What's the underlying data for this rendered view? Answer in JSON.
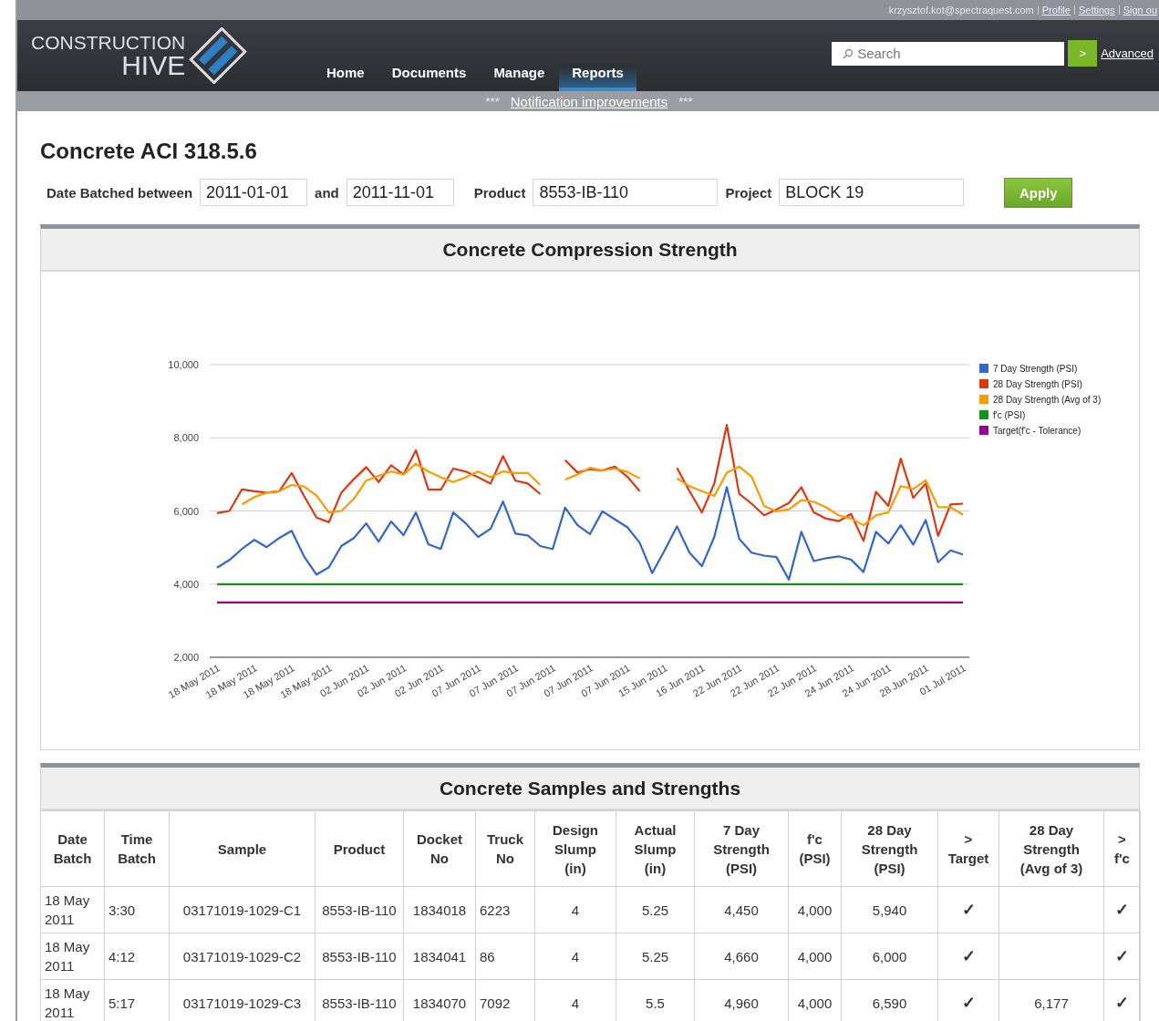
{
  "top_bar": {
    "user": "krzysztof.kot@spectraquest.com",
    "links": [
      "Profile",
      "Settings",
      "Sign ou"
    ]
  },
  "logo": {
    "line1": "CONSTRUCTION",
    "line2": "HIVE"
  },
  "nav": [
    {
      "label": "Home",
      "selected": false
    },
    {
      "label": "Documents",
      "selected": false
    },
    {
      "label": "Manage",
      "selected": false
    },
    {
      "label": "Reports",
      "selected": true
    }
  ],
  "search": {
    "placeholder": "Search",
    "go": ">",
    "advanced": "Advanced"
  },
  "notice": {
    "stars_left": "***",
    "link": "Notification improvements",
    "stars_right": "***"
  },
  "title": "Concrete ACI 318.5.6",
  "filters": {
    "date_label": "Date Batched between",
    "date_from": "2011-01-01",
    "and": "and",
    "date_to": "2011-11-01",
    "product_label": "Product",
    "product": "8553-IB-110",
    "project_label": "Project",
    "project": "BLOCK 19",
    "apply": "Apply"
  },
  "chart_panel": {
    "title": "Concrete Compression Strength",
    "chart_data": {
      "type": "line",
      "categories": [
        "18 May 2011",
        null,
        null,
        "18 May 2011",
        null,
        null,
        "18 May 2011",
        null,
        null,
        "18 May 2011",
        null,
        null,
        "02 Jun 2011",
        null,
        null,
        "02 Jun 2011",
        null,
        null,
        "02 Jun 2011",
        null,
        null,
        "07 Jun 2011",
        null,
        null,
        "07 Jun 2011",
        null,
        null,
        "07 Jun 2011",
        null,
        null,
        "07 Jun 2011",
        null,
        null,
        "07 Jun 2011",
        null,
        null,
        "15 Jun 2011",
        null,
        null,
        "16 Jun 2011",
        null,
        null,
        "22 Jun 2011",
        null,
        null,
        "22 Jun 2011",
        null,
        null,
        "22 Jun 2011",
        null,
        null,
        "24 Jun 2011",
        null,
        null,
        "24 Jun 2011",
        null,
        null,
        "28 Jun 2011",
        null,
        null,
        "01 Jul 2011"
      ],
      "ylim": [
        2000,
        10000
      ],
      "grid": true,
      "legend": "right",
      "yticks": [
        {
          "value": 2000,
          "label": "2,000"
        },
        {
          "value": 4000,
          "label": "4,000"
        },
        {
          "value": 6000,
          "label": "6,000"
        },
        {
          "value": 8000,
          "label": "8,000"
        },
        {
          "value": 10000,
          "label": "10,000"
        }
      ],
      "series": [
        {
          "name": "7 Day Strength (PSI)",
          "color": "#3366cc",
          "values": [
            4450,
            4660,
            4960,
            5210,
            5010,
            5260,
            5460,
            4760,
            4260,
            4460,
            5040,
            5260,
            5660,
            5160,
            5710,
            5340,
            5960,
            5090,
            4960,
            5960,
            5660,
            5290,
            5510,
            6260,
            5380,
            5330,
            5040,
            4960,
            6090,
            5610,
            5370,
            5990,
            5770,
            5560,
            5130,
            4300,
            4920,
            5580,
            4860,
            4490,
            5290,
            6650,
            5240,
            4860,
            4780,
            4740,
            4120,
            5430,
            4630,
            4710,
            4760,
            4670,
            4330,
            5430,
            5110,
            5610,
            5080,
            5750,
            4600,
            4920,
            4810
          ]
        },
        {
          "name": "28 Day Strength (PSI)",
          "color": "#dc3912",
          "values": [
            5940,
            6000,
            6590,
            6540,
            6500,
            6540,
            7040,
            6410,
            5820,
            5690,
            6500,
            6870,
            7200,
            6790,
            7250,
            7000,
            7660,
            6580,
            6580,
            7160,
            7080,
            6920,
            6750,
            7500,
            6830,
            6750,
            6460,
            null,
            7390,
            7050,
            7140,
            7110,
            7210,
            6940,
            6540,
            null,
            null,
            7180,
            6540,
            5960,
            6750,
            8350,
            6470,
            6200,
            5880,
            6040,
            6220,
            6650,
            5960,
            5790,
            5720,
            5920,
            5180,
            6520,
            6140,
            7430,
            6360,
            6750,
            5320,
            6180,
            6200
          ]
        },
        {
          "name": "28 Day Strength (Avg of 3)",
          "color": "#ff9900",
          "values": [
            null,
            null,
            6180,
            6380,
            6500,
            6540,
            6710,
            6670,
            6420,
            5960,
            6000,
            6330,
            6830,
            6960,
            7080,
            7000,
            7290,
            7080,
            6920,
            6790,
            6920,
            7080,
            6920,
            7080,
            7040,
            7040,
            6710,
            null,
            6860,
            7000,
            7180,
            7110,
            7160,
            7070,
            6890,
            null,
            null,
            6890,
            6680,
            6540,
            6410,
            7050,
            7210,
            6940,
            6140,
            5990,
            6040,
            6300,
            6250,
            6100,
            5880,
            5790,
            5610,
            5880,
            5960,
            6680,
            6600,
            6840,
            6110,
            6100,
            5900
          ]
        },
        {
          "name": "f'c (PSI)",
          "color": "#109618",
          "values": [
            4000,
            4000,
            4000,
            4000,
            4000,
            4000,
            4000,
            4000,
            4000,
            4000,
            4000,
            4000,
            4000,
            4000,
            4000,
            4000,
            4000,
            4000,
            4000,
            4000,
            4000,
            4000,
            4000,
            4000,
            4000,
            4000,
            4000,
            4000,
            4000,
            4000,
            4000,
            4000,
            4000,
            4000,
            4000,
            4000,
            4000,
            4000,
            4000,
            4000,
            4000,
            4000,
            4000,
            4000,
            4000,
            4000,
            4000,
            4000,
            4000,
            4000,
            4000,
            4000,
            4000,
            4000,
            4000,
            4000,
            4000,
            4000,
            4000,
            4000,
            4000
          ]
        },
        {
          "name": "Target(f'c - Tolerance)",
          "color": "#990099",
          "values": [
            3500,
            3500,
            3500,
            3500,
            3500,
            3500,
            3500,
            3500,
            3500,
            3500,
            3500,
            3500,
            3500,
            3500,
            3500,
            3500,
            3500,
            3500,
            3500,
            3500,
            3500,
            3500,
            3500,
            3500,
            3500,
            3500,
            3500,
            3500,
            3500,
            3500,
            3500,
            3500,
            3500,
            3500,
            3500,
            3500,
            3500,
            3500,
            3500,
            3500,
            3500,
            3500,
            3500,
            3500,
            3500,
            3500,
            3500,
            3500,
            3500,
            3500,
            3500,
            3500,
            3500,
            3500,
            3500,
            3500,
            3500,
            3500,
            3500,
            3500,
            3500
          ]
        }
      ]
    }
  },
  "table_panel": {
    "title": "Concrete Samples and Strengths",
    "columns": [
      "Date Batch",
      "Time Batch",
      "Sample",
      "Product",
      "Docket No",
      "Truck No",
      "Design Slump (in)",
      "Actual Slump (in)",
      "7 Day Strength (PSI)",
      "f'c (PSI)",
      "28 Day Strength (PSI)",
      "> Target",
      "28 Day Strength (Avg of 3)",
      "> f'c"
    ],
    "rows": [
      [
        "18 May 2011",
        "3:30",
        "03171019-1029-C1",
        "8553-IB-110",
        "1834018",
        "6223",
        "4",
        "5.25",
        "4,450",
        "4,000",
        "5,940",
        "✓",
        "",
        "✓"
      ],
      [
        "18 May 2011",
        "4:12",
        "03171019-1029-C2",
        "8553-IB-110",
        "1834041",
        "86",
        "4",
        "5.25",
        "4,660",
        "4,000",
        "6,000",
        "✓",
        "",
        "✓"
      ],
      [
        "18 May 2011",
        "5:17",
        "03171019-1029-C3",
        "8553-IB-110",
        "1834070",
        "7092",
        "4",
        "5.5",
        "4,960",
        "4,000",
        "6,590",
        "✓",
        "6,177",
        "✓"
      ]
    ]
  }
}
